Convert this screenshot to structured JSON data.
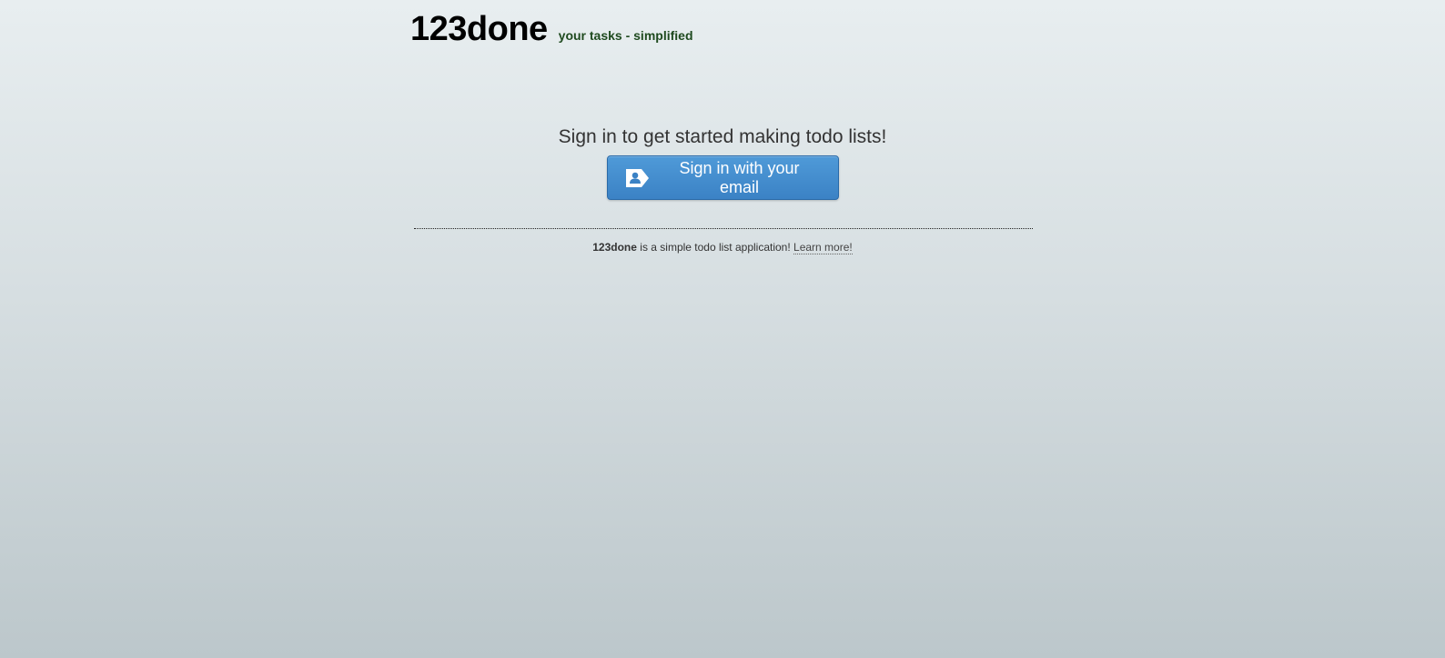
{
  "header": {
    "brand": "123done",
    "tagline": "your tasks - simplified"
  },
  "main": {
    "prompt": "Sign in to get started making todo lists!",
    "signin_button": {
      "label": "Sign in with your email",
      "icon": "persona-badge-icon"
    }
  },
  "footer": {
    "app_name": "123done",
    "description": " is a simple todo list application! ",
    "learn_more": "Learn more!"
  },
  "colors": {
    "button": "#3b82c5",
    "tagline": "#1f4a1f"
  }
}
